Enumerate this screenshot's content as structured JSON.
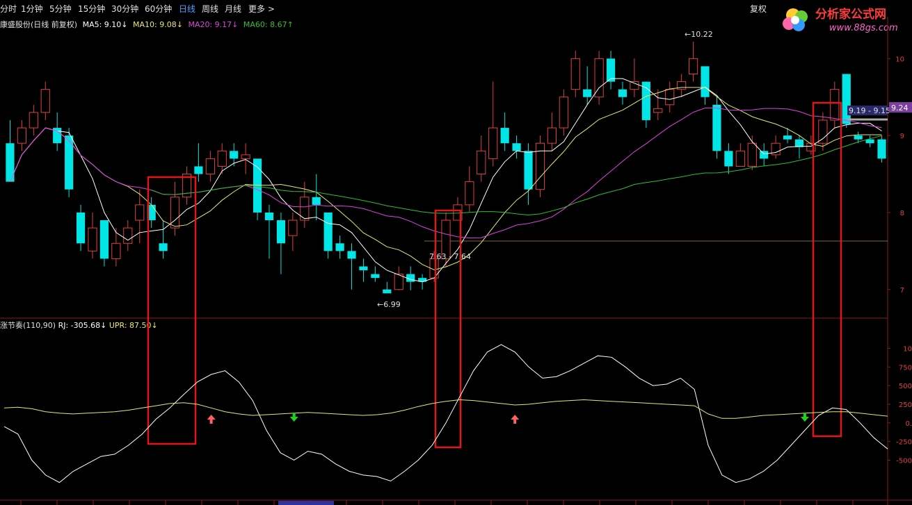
{
  "toolbar": {
    "tabs": [
      "分时",
      "1分钟",
      "5分钟",
      "15分钟",
      "30分钟",
      "60分钟",
      "日线",
      "周线",
      "月线",
      "更多 >"
    ],
    "active": "日线",
    "right": "复权"
  },
  "logo": {
    "title": "分析家公式网",
    "url": "www.88gs.com"
  },
  "legend_main": {
    "stock": "康盛股份(日线 前复权)",
    "ma5": "MA5: 9.10↓",
    "ma10": "MA10: 9.08↓",
    "ma20": "MA20: 9.17↓",
    "ma60": "MA60: 8.67↑"
  },
  "legend_sub": {
    "name": "涨节奏(110,90)",
    "rj": "RJ: -305.68↓",
    "upr": "UPR: 87.50↓"
  },
  "colors": {
    "up": "#e04040",
    "down": "#00e5e5",
    "ma5": "#ffffff",
    "ma10": "#e8e870",
    "ma20": "#e040e0",
    "ma60": "#30c030",
    "box": "#e01818"
  },
  "chart_data": [
    {
      "type": "candlestick",
      "title": "康盛股份(日线 前复权)",
      "y_ticks": [
        "10",
        "9",
        "8",
        "7"
      ],
      "price_axis_labels": [
        "10",
        "9.",
        "12",
        "9.",
        "-0",
        "9.24",
        "19",
        "8",
        "8",
        "7"
      ],
      "annotations": [
        "10.22",
        "6.99",
        "7.63 - 7.64",
        "9.19 - 9.15",
        "9.24"
      ],
      "candles": [
        {
          "o": 8.9,
          "c": 8.4,
          "h": 9.2,
          "l": 8.4
        },
        {
          "o": 8.9,
          "c": 9.1,
          "h": 9.2,
          "l": 8.8
        },
        {
          "o": 9.1,
          "c": 9.3,
          "h": 9.4,
          "l": 9.0
        },
        {
          "o": 9.3,
          "c": 9.6,
          "h": 9.7,
          "l": 9.2
        },
        {
          "o": 9.1,
          "c": 8.9,
          "h": 9.3,
          "l": 8.8
        },
        {
          "o": 9.0,
          "c": 8.3,
          "h": 9.1,
          "l": 8.2
        },
        {
          "o": 8.0,
          "c": 7.6,
          "h": 8.1,
          "l": 7.5
        },
        {
          "o": 7.5,
          "c": 7.8,
          "h": 8.0,
          "l": 7.4
        },
        {
          "o": 7.9,
          "c": 7.4,
          "h": 7.9,
          "l": 7.3
        },
        {
          "o": 7.4,
          "c": 7.6,
          "h": 7.8,
          "l": 7.3
        },
        {
          "o": 7.6,
          "c": 7.8,
          "h": 7.9,
          "l": 7.5
        },
        {
          "o": 7.9,
          "c": 8.1,
          "h": 8.3,
          "l": 7.6
        },
        {
          "o": 8.1,
          "c": 7.9,
          "h": 8.2,
          "l": 7.8
        },
        {
          "o": 7.6,
          "c": 7.5,
          "h": 7.9,
          "l": 7.4
        },
        {
          "o": 7.8,
          "c": 8.2,
          "h": 8.4,
          "l": 7.7
        },
        {
          "o": 8.2,
          "c": 8.5,
          "h": 8.6,
          "l": 8.1
        },
        {
          "o": 8.6,
          "c": 8.5,
          "h": 8.9,
          "l": 8.4
        },
        {
          "o": 8.5,
          "c": 8.7,
          "h": 8.8,
          "l": 8.4
        },
        {
          "o": 8.6,
          "c": 8.8,
          "h": 8.9,
          "l": 8.5
        },
        {
          "o": 8.8,
          "c": 8.7,
          "h": 8.9,
          "l": 8.6
        },
        {
          "o": 8.7,
          "c": 8.75,
          "h": 8.9,
          "l": 8.5
        },
        {
          "o": 8.7,
          "c": 8.0,
          "h": 8.7,
          "l": 7.9
        },
        {
          "o": 8.0,
          "c": 7.9,
          "h": 8.1,
          "l": 7.4
        },
        {
          "o": 7.9,
          "c": 7.6,
          "h": 8.0,
          "l": 7.2
        },
        {
          "o": 7.7,
          "c": 7.9,
          "h": 8.0,
          "l": 7.5
        },
        {
          "o": 7.9,
          "c": 8.2,
          "h": 8.4,
          "l": 7.8
        },
        {
          "o": 8.2,
          "c": 8.1,
          "h": 8.5,
          "l": 7.9
        },
        {
          "o": 8.0,
          "c": 7.5,
          "h": 8.0,
          "l": 7.4
        },
        {
          "o": 7.6,
          "c": 7.5,
          "h": 7.7,
          "l": 7.4
        },
        {
          "o": 7.5,
          "c": 7.4,
          "h": 7.6,
          "l": 7.0
        },
        {
          "o": 7.3,
          "c": 7.25,
          "h": 7.4,
          "l": 7.1
        },
        {
          "o": 7.2,
          "c": 7.15,
          "h": 7.3,
          "l": 7.1
        },
        {
          "o": 7.0,
          "c": 6.95,
          "h": 7.1,
          "l": 6.99
        },
        {
          "o": 7.0,
          "c": 7.2,
          "h": 7.3,
          "l": 6.99
        },
        {
          "o": 7.2,
          "c": 7.1,
          "h": 7.3,
          "l": 6.99
        },
        {
          "o": 7.15,
          "c": 7.1,
          "h": 7.2,
          "l": 7.0
        },
        {
          "o": 7.15,
          "c": 7.4,
          "h": 7.5,
          "l": 7.1
        },
        {
          "o": 7.4,
          "c": 7.9,
          "h": 8.0,
          "l": 7.3
        },
        {
          "o": 7.9,
          "c": 8.1,
          "h": 8.2,
          "l": 7.9
        },
        {
          "o": 8.1,
          "c": 8.4,
          "h": 8.6,
          "l": 8.0
        },
        {
          "o": 8.5,
          "c": 8.8,
          "h": 9.0,
          "l": 8.4
        },
        {
          "o": 8.7,
          "c": 9.1,
          "h": 9.7,
          "l": 8.6
        },
        {
          "o": 9.1,
          "c": 8.9,
          "h": 9.3,
          "l": 8.8
        },
        {
          "o": 8.9,
          "c": 8.8,
          "h": 9.0,
          "l": 8.7
        },
        {
          "o": 8.8,
          "c": 8.3,
          "h": 8.9,
          "l": 8.1
        },
        {
          "o": 8.3,
          "c": 8.9,
          "h": 9.0,
          "l": 8.2
        },
        {
          "o": 8.9,
          "c": 9.1,
          "h": 9.3,
          "l": 8.8
        },
        {
          "o": 9.1,
          "c": 9.5,
          "h": 9.6,
          "l": 9.0
        },
        {
          "o": 9.6,
          "c": 10.0,
          "h": 10.1,
          "l": 9.5
        },
        {
          "o": 9.6,
          "c": 9.5,
          "h": 9.9,
          "l": 9.4
        },
        {
          "o": 9.5,
          "c": 10.0,
          "h": 10.1,
          "l": 9.4
        },
        {
          "o": 10.0,
          "c": 9.7,
          "h": 10.1,
          "l": 9.6
        },
        {
          "o": 9.6,
          "c": 9.5,
          "h": 9.7,
          "l": 9.4
        },
        {
          "o": 9.6,
          "c": 9.7,
          "h": 10.0,
          "l": 9.5
        },
        {
          "o": 9.7,
          "c": 9.2,
          "h": 9.7,
          "l": 9.1
        },
        {
          "o": 9.3,
          "c": 9.35,
          "h": 9.6,
          "l": 9.2
        },
        {
          "o": 9.4,
          "c": 9.6,
          "h": 9.7,
          "l": 9.3
        },
        {
          "o": 9.6,
          "c": 9.7,
          "h": 9.8,
          "l": 9.5
        },
        {
          "o": 9.8,
          "c": 10.0,
          "h": 10.22,
          "l": 9.7
        },
        {
          "o": 9.9,
          "c": 9.5,
          "h": 9.9,
          "l": 9.4
        },
        {
          "o": 9.4,
          "c": 8.8,
          "h": 9.5,
          "l": 8.7
        },
        {
          "o": 8.8,
          "c": 8.6,
          "h": 8.9,
          "l": 8.5
        },
        {
          "o": 8.6,
          "c": 8.8,
          "h": 8.9,
          "l": 8.6
        },
        {
          "o": 8.6,
          "c": 8.9,
          "h": 9.0,
          "l": 8.55
        },
        {
          "o": 8.8,
          "c": 8.7,
          "h": 8.9,
          "l": 8.6
        },
        {
          "o": 8.75,
          "c": 8.9,
          "h": 9.0,
          "l": 8.7
        },
        {
          "o": 9.0,
          "c": 8.95,
          "h": 9.1,
          "l": 8.9
        },
        {
          "o": 8.95,
          "c": 8.85,
          "h": 9.0,
          "l": 8.7
        },
        {
          "o": 8.8,
          "c": 8.9,
          "h": 9.0,
          "l": 8.75
        },
        {
          "o": 8.9,
          "c": 9.2,
          "h": 9.3,
          "l": 8.8
        },
        {
          "o": 9.2,
          "c": 9.6,
          "h": 9.7,
          "l": 9.1
        },
        {
          "o": 9.8,
          "c": 9.15,
          "h": 9.8,
          "l": 9.1
        },
        {
          "o": 9.0,
          "c": 8.95,
          "h": 9.05,
          "l": 8.9
        },
        {
          "o": 8.95,
          "c": 8.9,
          "h": 9.0,
          "l": 8.85
        },
        {
          "o": 8.95,
          "c": 8.7,
          "h": 9.0,
          "l": 8.65
        }
      ]
    },
    {
      "type": "line",
      "title": "涨节奏(110,90)",
      "y_ticks": [
        "10",
        "750",
        "500",
        "250",
        "0.",
        "-250",
        "-500"
      ],
      "series": [
        {
          "name": "RJ",
          "values": [
            -50,
            -150,
            -500,
            -700,
            -800,
            -650,
            -550,
            -450,
            -420,
            -300,
            -150,
            50,
            200,
            380,
            550,
            650,
            700,
            550,
            300,
            -100,
            -400,
            -500,
            -380,
            -420,
            -550,
            -650,
            -700,
            -720,
            -780,
            -650,
            -500,
            -300,
            0,
            350,
            700,
            950,
            1050,
            950,
            750,
            600,
            620,
            700,
            800,
            900,
            880,
            750,
            600,
            500,
            520,
            600,
            450,
            -300,
            -700,
            -800,
            -750,
            -650,
            -500,
            -300,
            -100,
            100,
            200,
            180,
            0,
            -200,
            -350
          ]
        },
        {
          "name": "UPR",
          "values": [
            200,
            210,
            190,
            150,
            130,
            120,
            130,
            140,
            150,
            170,
            200,
            230,
            260,
            270,
            250,
            200,
            150,
            120,
            100,
            110,
            120,
            130,
            140,
            130,
            120,
            110,
            100,
            110,
            130,
            170,
            220,
            260,
            290,
            310,
            300,
            280,
            260,
            240,
            250,
            270,
            290,
            300,
            310,
            300,
            290,
            280,
            270,
            260,
            250,
            240,
            230,
            120,
            60,
            60,
            80,
            100,
            110,
            120,
            130,
            140,
            150,
            150,
            130,
            110,
            90
          ]
        }
      ],
      "signals": [
        {
          "type": "buy",
          "x": 15
        },
        {
          "type": "sell",
          "x": 21
        },
        {
          "type": "buy",
          "x": 37
        },
        {
          "type": "sell",
          "x": 58
        },
        {
          "type": "buy",
          "x": 68
        },
        {
          "type": "sell",
          "x": 70
        }
      ]
    }
  ]
}
